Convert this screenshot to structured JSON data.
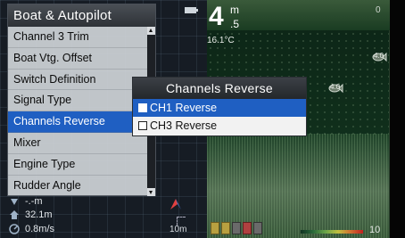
{
  "map": {
    "scale": "10m",
    "status": {
      "row1": "-.-m",
      "distance": "32.1m",
      "speed": "0.8m/s"
    }
  },
  "sonar": {
    "depth_integer": "4",
    "depth_unit": "m",
    "depth_decimal": ".5",
    "water_temp": "16.1°C",
    "range_top": "0",
    "range_bottom": "10",
    "fish_1": "4.0",
    "fish_2": "4.0"
  },
  "menu": {
    "title": "Boat & Autopilot",
    "items": [
      {
        "label": "Channel 3 Trim"
      },
      {
        "label": "Boat Vtg. Offset"
      },
      {
        "label": "Switch Definition"
      },
      {
        "label": "Signal Type"
      },
      {
        "label": "Channels Reverse",
        "selected": true
      },
      {
        "label": "Mixer"
      },
      {
        "label": "Engine Type"
      },
      {
        "label": "Rudder Angle"
      }
    ]
  },
  "dialog": {
    "title": "Channels Reverse",
    "options": [
      {
        "label": "CH1 Reverse",
        "checked": false,
        "selected": true
      },
      {
        "label": "CH3 Reverse",
        "checked": false,
        "selected": false
      }
    ]
  },
  "colors": {
    "selection": "#1f5fc2",
    "menu_bg": "#cdd2d6",
    "sonar_bg": "#10301c"
  }
}
